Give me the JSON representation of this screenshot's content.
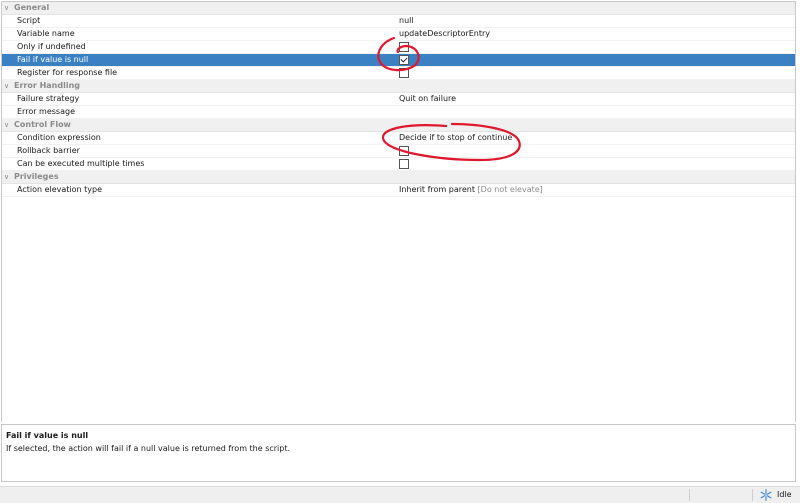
{
  "sections": [
    {
      "label": "General",
      "rows": [
        {
          "name": "Script",
          "type": "text",
          "value": "null"
        },
        {
          "name": "Variable name",
          "type": "text",
          "value": "updateDescriptorEntry"
        },
        {
          "name": "Only if undefined",
          "type": "checkbox",
          "checked": false
        },
        {
          "name": "Fail if value is null",
          "type": "checkbox",
          "checked": true,
          "selected": true
        },
        {
          "name": "Register for response file",
          "type": "checkbox",
          "checked": false
        }
      ]
    },
    {
      "label": "Error Handling",
      "rows": [
        {
          "name": "Failure strategy",
          "type": "text",
          "value": "Quit on failure"
        },
        {
          "name": "Error message",
          "type": "text",
          "value": ""
        }
      ]
    },
    {
      "label": "Control Flow",
      "rows": [
        {
          "name": "Condition expression",
          "type": "text",
          "value": "Decide if to stop of continue"
        },
        {
          "name": "Rollback barrier",
          "type": "checkbox",
          "checked": false
        },
        {
          "name": "Can be executed multiple times",
          "type": "checkbox",
          "checked": false
        }
      ]
    },
    {
      "label": "Privileges",
      "rows": [
        {
          "name": "Action elevation type",
          "type": "text",
          "value": "Inherit from parent",
          "hint": "[Do not elevate]"
        }
      ]
    }
  ],
  "description": {
    "title": "Fail if value is null",
    "text": "If selected, the action will fail if a null value is returned from the script."
  },
  "status": {
    "icon": "snowflake-icon",
    "state": "Idle"
  },
  "colors": {
    "selection": "#3a80c3",
    "annotation": "#e0182d"
  }
}
